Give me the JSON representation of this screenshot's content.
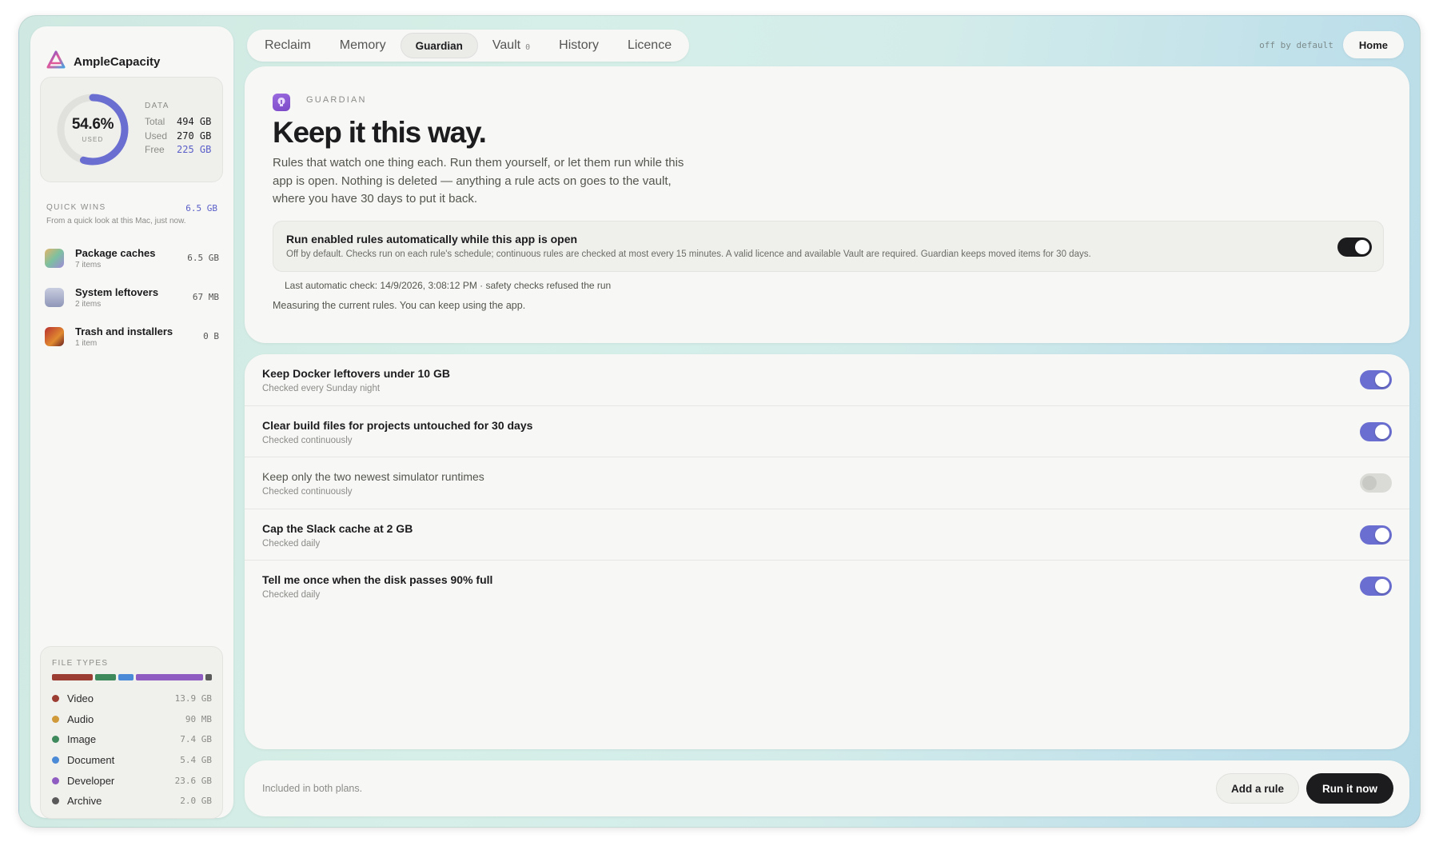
{
  "app": {
    "name": "AmpleCapacity"
  },
  "usage": {
    "percent_label": "54.6%",
    "percent_value": 54.6,
    "used_label": "USED",
    "data_heading": "DATA",
    "rows": [
      {
        "key": "Total",
        "value": "494 GB"
      },
      {
        "key": "Used",
        "value": "270 GB"
      },
      {
        "key": "Free",
        "value": "225 GB"
      }
    ],
    "ring_color": "#6a6ed0"
  },
  "quick_wins": {
    "heading": "QUICK WINS",
    "total": "6.5 GB",
    "subtitle": "From a quick look at this Mac, just now.",
    "items": [
      {
        "name": "Package caches",
        "count": "7 items",
        "size": "6.5 GB",
        "icon": "package-caches-icon"
      },
      {
        "name": "System leftovers",
        "count": "2 items",
        "size": "67 MB",
        "icon": "system-leftovers-icon"
      },
      {
        "name": "Trash and installers",
        "count": "1 item",
        "size": "0 B",
        "icon": "trash-installers-icon"
      }
    ]
  },
  "file_types": {
    "heading": "FILE TYPES",
    "items": [
      {
        "name": "Video",
        "size": "13.9 GB",
        "color": "#9c3d33",
        "share": 0.27
      },
      {
        "name": "Audio",
        "size": "90 MB",
        "color": "#d09a3a",
        "share": 0.0
      },
      {
        "name": "Image",
        "size": "7.4 GB",
        "color": "#3f8a5d",
        "share": 0.14
      },
      {
        "name": "Document",
        "size": "5.4 GB",
        "color": "#4b8ad6",
        "share": 0.1
      },
      {
        "name": "Developer",
        "size": "23.6 GB",
        "color": "#8f5cc2",
        "share": 0.45
      },
      {
        "name": "Archive",
        "size": "2.0 GB",
        "color": "#5a5a5a",
        "share": 0.04
      }
    ]
  },
  "tabs": [
    {
      "label": "Reclaim",
      "active": false
    },
    {
      "label": "Memory",
      "active": false
    },
    {
      "label": "Guardian",
      "active": true
    },
    {
      "label": "Vault",
      "badge": "0",
      "active": false
    },
    {
      "label": "History",
      "active": false
    },
    {
      "label": "Licence",
      "active": false
    }
  ],
  "topbar": {
    "status": "off by default",
    "home_label": "Home"
  },
  "guardian": {
    "eyebrow": "GUARDIAN",
    "title": "Keep it this way.",
    "description": "Rules that watch one thing each. Run them yourself, or let them run while this app is open. Nothing is deleted — anything a rule acts on goes to the vault, where you have 30 days to put it back.",
    "auto": {
      "title": "Run enabled rules automatically while this app is open",
      "subtitle": "Off by default. Checks run on each rule's schedule; continuous rules are checked at most every 15 minutes. A valid licence and available Vault are required. Guardian keeps moved items for 30 days.",
      "enabled": true
    },
    "last_check": "Last automatic check: 14/9/2026, 3:08:12 PM · safety checks refused the run",
    "measuring": "Measuring the current rules. You can keep using the app."
  },
  "rules": [
    {
      "title": "Keep Docker leftovers under 10 GB",
      "schedule": "Checked every Sunday night",
      "enabled": true
    },
    {
      "title": "Clear build files for projects untouched for 30 days",
      "schedule": "Checked continuously",
      "enabled": true
    },
    {
      "title": "Keep only the two newest simulator runtimes",
      "schedule": "Checked continuously",
      "enabled": false
    },
    {
      "title": "Cap the Slack cache at 2 GB",
      "schedule": "Checked daily",
      "enabled": true
    },
    {
      "title": "Tell me once when the disk passes 90% full",
      "schedule": "Checked daily",
      "enabled": true
    }
  ],
  "footer": {
    "note": "Included in both plans.",
    "add_label": "Add a rule",
    "run_label": "Run it now"
  }
}
